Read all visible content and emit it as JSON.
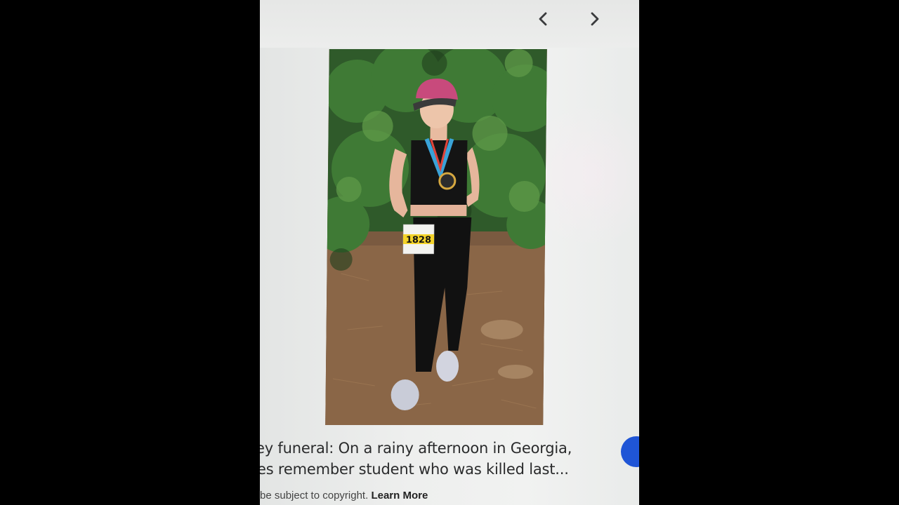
{
  "nav": {
    "prev_icon": "chevron-left-icon",
    "next_icon": "chevron-right-icon"
  },
  "image": {
    "bib_number": "1828"
  },
  "caption": {
    "line1": "ey funeral: On a rainy afternoon in Georgia,",
    "line2": "es remember student who was killed last..."
  },
  "copyright": {
    "text": "be subject to copyright.",
    "learn_more": "Learn More"
  },
  "colors": {
    "accent_blue": "#1f55d6"
  }
}
